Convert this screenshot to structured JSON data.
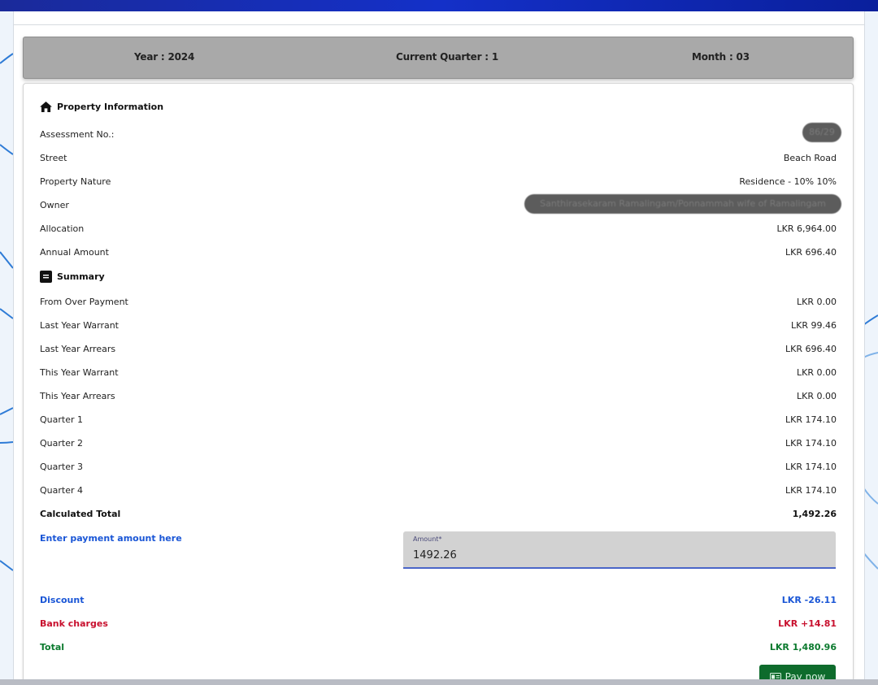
{
  "period": {
    "year": "Year : 2024",
    "quarter": "Current Quarter : 1",
    "month": "Month : 03"
  },
  "property": {
    "title": "Property Information",
    "rows": [
      {
        "label": "Assessment No.:",
        "value": "86/29",
        "redacted": true
      },
      {
        "label": "Street",
        "value": "Beach Road"
      },
      {
        "label": "Property Nature",
        "value": "Residence - 10% 10%"
      },
      {
        "label": "Owner",
        "value": "Santhirasekaram Ramalingam/Ponnammah wife of Ramalingam",
        "redacted": true
      },
      {
        "label": "Allocation",
        "value": "LKR 6,964.00"
      },
      {
        "label": "Annual Amount",
        "value": "LKR 696.40"
      }
    ]
  },
  "summary": {
    "title": "Summary",
    "rows": [
      {
        "label": "From Over Payment",
        "value": "LKR 0.00"
      },
      {
        "label": "Last Year Warrant",
        "value": "LKR 99.46"
      },
      {
        "label": "Last Year Arrears",
        "value": "LKR 696.40"
      },
      {
        "label": "This Year Warrant",
        "value": "LKR 0.00"
      },
      {
        "label": "This Year Arrears",
        "value": "LKR 0.00"
      },
      {
        "label": "Quarter 1",
        "value": "LKR 174.10"
      },
      {
        "label": "Quarter 2",
        "value": "LKR 174.10"
      },
      {
        "label": "Quarter 3",
        "value": "LKR 174.10"
      },
      {
        "label": "Quarter 4",
        "value": "LKR 174.10"
      }
    ],
    "calculated_total_label": "Calculated Total",
    "calculated_total_value": "1,492.26"
  },
  "payment": {
    "prompt": "Enter payment amount here",
    "amount_label": "Amount*",
    "amount_value": "1492.26",
    "discount_label": "Discount",
    "discount_value": "LKR -26.11",
    "bank_label": "Bank charges",
    "bank_value": "LKR +14.81",
    "total_label": "Total",
    "total_value": "LKR 1,480.96",
    "pay_button": "Pay now"
  },
  "colors": {
    "discount": "#1a56d6",
    "bank_charges": "#c8102e",
    "total": "#0b7a2e",
    "pay_button": "#0e6b2c",
    "period_bar": "#a9a9a9"
  }
}
